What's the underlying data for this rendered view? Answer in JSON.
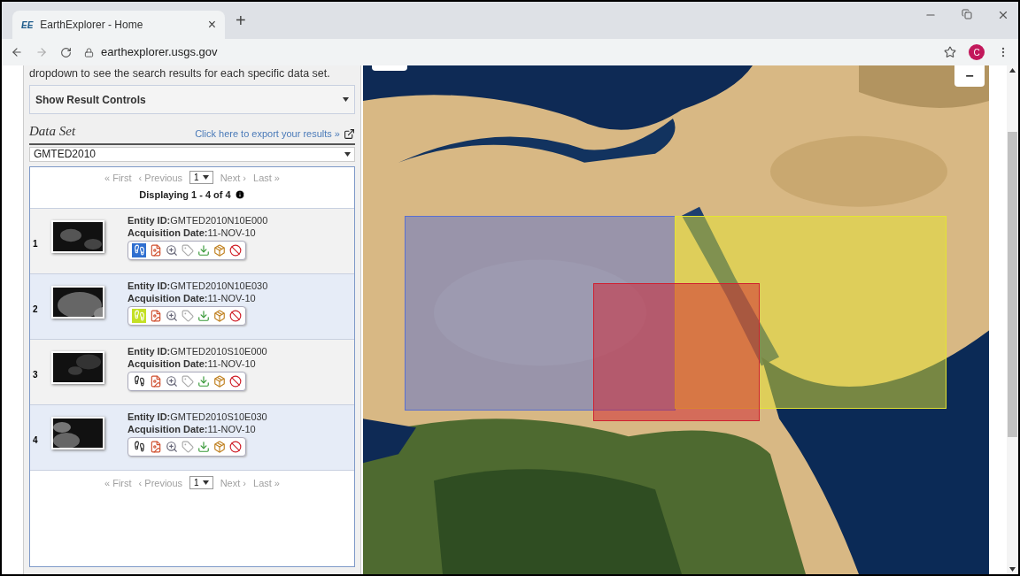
{
  "browser": {
    "tab_title": "EarthExplorer - Home",
    "tab_logo": "EE",
    "tab_close": "×",
    "new_tab": "+",
    "url": "earthexplorer.usgs.gov",
    "profile_initial": "C"
  },
  "panel": {
    "intro": "dropdown to see the search results for each specific data set.",
    "result_controls": "Show Result Controls",
    "data_set_label": "Data Set",
    "export_link": "Click here to export your results »",
    "data_set_value": "GMTED2010",
    "pager_top": {
      "first": "« First",
      "previous": "‹ Previous",
      "page": "1",
      "next": "Next ›",
      "last": "Last »"
    },
    "displaying": "Displaying 1 - 4 of 4",
    "results": [
      {
        "index": "1",
        "entity_label": "Entity ID:",
        "entity_id": "GMTED2010N10E000",
        "date_label": "Acquisition Date:",
        "date": "11-NOV-10",
        "footprint_shown": true,
        "color": "#2f6fd0"
      },
      {
        "index": "2",
        "entity_label": "Entity ID:",
        "entity_id": "GMTED2010N10E030",
        "date_label": "Acquisition Date:",
        "date": "11-NOV-10",
        "footprint_shown": true,
        "color": "#c4e024"
      },
      {
        "index": "3",
        "entity_label": "Entity ID:",
        "entity_id": "GMTED2010S10E000",
        "date_label": "Acquisition Date:",
        "date": "11-NOV-10",
        "footprint_shown": false
      },
      {
        "index": "4",
        "entity_label": "Entity ID:",
        "entity_id": "GMTED2010S10E030",
        "date_label": "Acquisition Date:",
        "date": "11-NOV-10",
        "footprint_shown": false
      }
    ],
    "pager_bottom": {
      "first": "« First",
      "previous": "‹ Previous",
      "page": "1",
      "next": "Next ›",
      "last": "Last »"
    }
  },
  "map": {
    "zoom_out": "−",
    "footprints": [
      {
        "color": "#5a6fd0"
      },
      {
        "color": "#e4e430"
      },
      {
        "color": "#d02030"
      }
    ]
  }
}
